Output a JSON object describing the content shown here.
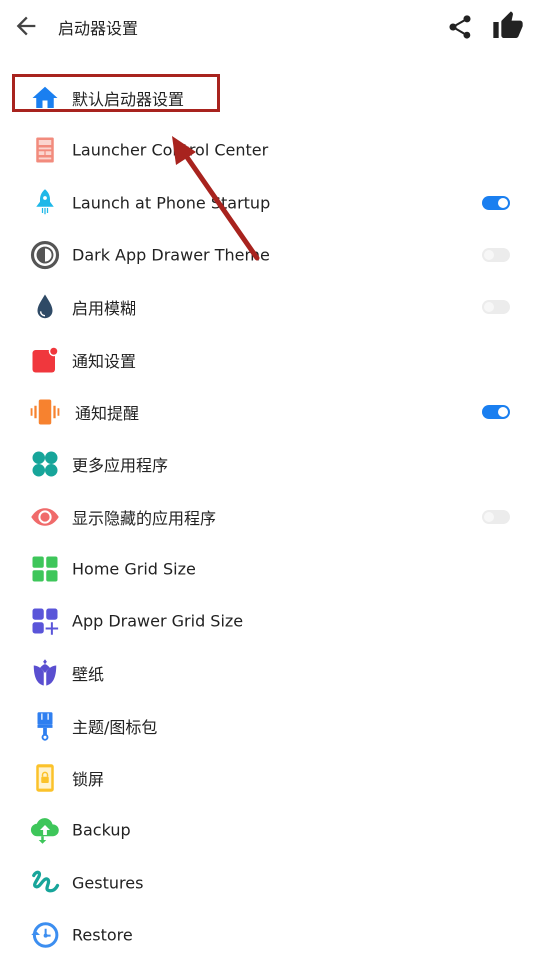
{
  "header": {
    "title": "启动器设置",
    "back_icon": "arrow-left-icon",
    "share_icon": "share-icon",
    "like_icon": "thumbs-up-icon"
  },
  "colors": {
    "toggle_on": "#1a7ff0",
    "toggle_off": "#ececec",
    "annotation": "#a8231e"
  },
  "items": [
    {
      "label": "默认启动器设置",
      "icon": "home-icon",
      "highlighted": true
    },
    {
      "label": "Launcher Control Center",
      "icon": "control-center-icon"
    },
    {
      "label": "Launch at Phone Startup",
      "icon": "rocket-icon",
      "toggle": true
    },
    {
      "label": "Dark App Drawer Theme",
      "icon": "contrast-icon",
      "toggle": false
    },
    {
      "label": "启用模糊",
      "icon": "drop-icon",
      "toggle": false
    },
    {
      "label": "通知设置",
      "icon": "notification-icon"
    },
    {
      "label": "通知提醒",
      "icon": "vibrate-icon",
      "toggle": true
    },
    {
      "label": "更多应用程序",
      "icon": "apps-icon"
    },
    {
      "label": "显示隐藏的应用程序",
      "icon": "eye-icon",
      "toggle": false
    },
    {
      "label": "Home Grid Size",
      "icon": "grid-icon"
    },
    {
      "label": "App Drawer Grid Size",
      "icon": "grid-add-icon"
    },
    {
      "label": "壁纸",
      "icon": "tulip-icon"
    },
    {
      "label": "主题/图标包",
      "icon": "brush-icon"
    },
    {
      "label": "锁屏",
      "icon": "lock-screen-icon"
    },
    {
      "label": "Backup",
      "icon": "cloud-backup-icon"
    },
    {
      "label": "Gestures",
      "icon": "gesture-icon"
    },
    {
      "label": "Restore",
      "icon": "restore-icon"
    }
  ]
}
